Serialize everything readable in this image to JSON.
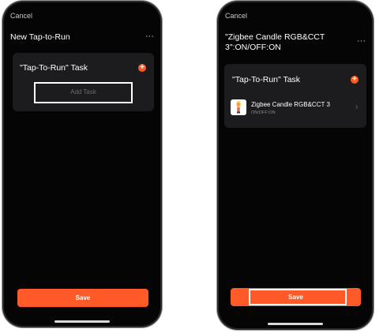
{
  "left_screen": {
    "cancel": "Cancel",
    "title": "New Tap-to-Run",
    "more": "···",
    "task_card_title": "\"Tap-To-Run\" Task",
    "add_task_placeholder": "Add Task",
    "save_label": "Save"
  },
  "right_screen": {
    "cancel": "Cancel",
    "title_line1": "\"Zigbee Candle RGB&CCT",
    "title_line2": "3\":ON/OFF:ON",
    "more": "···",
    "task_card_title": "\"Tap-To-Run\" Task",
    "device_name": "Zigbee Candle RGB&CCT 3",
    "device_status": "ON/OFF:ON",
    "save_label": "Save"
  },
  "colors": {
    "accent": "#ff5a28",
    "screen_bg": "#050505",
    "card_bg": "#1c1c1e",
    "highlight_outline": "#ffffff"
  },
  "icons": [
    "plus-circle-icon",
    "more-icon",
    "chevron-right-icon",
    "candle-bulb-icon"
  ]
}
